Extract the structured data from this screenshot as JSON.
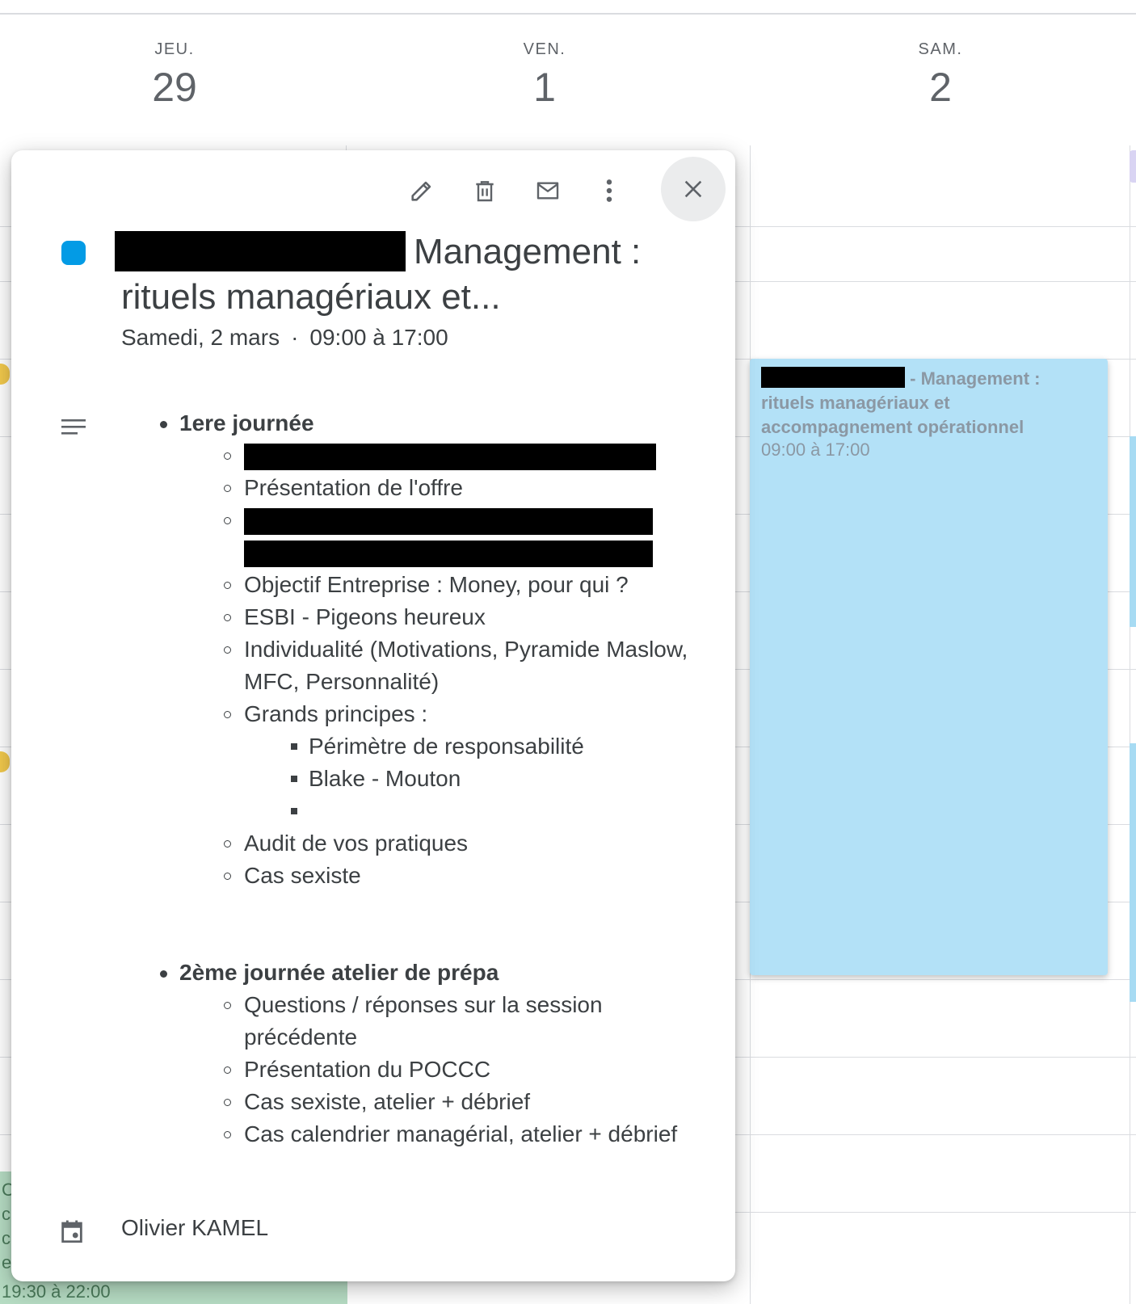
{
  "days": [
    {
      "dow": "JEU.",
      "num": "29"
    },
    {
      "dow": "VEN.",
      "num": "1"
    },
    {
      "dow": "SAM.",
      "num": "2"
    }
  ],
  "toolbar": {
    "edit_icon": "pencil-icon",
    "delete_icon": "trash-icon",
    "email_icon": "mail-icon",
    "more_icon": "more-vert-icon",
    "close_icon": "close-icon"
  },
  "event": {
    "color": "#039be5",
    "title_line1": "Management :",
    "title_line2": "rituels managériaux et...",
    "date": "Samedi, 2 mars",
    "separator": "·",
    "time": "09:00 à 17:00",
    "owner": "Olivier KAMEL"
  },
  "description": {
    "day1": {
      "heading": "1ere journée",
      "items": [
        "Présentation de l'offre",
        "Objectif Entreprise : Money, pour qui ?",
        "ESBI - Pigeons heureux",
        "Individualité (Motivations, Pyramide Maslow, MFC, Personnalité)",
        "Grands principes :",
        "Audit de vos pratiques",
        "Cas sexiste"
      ],
      "sub_items": [
        "Périmètre de responsabilité",
        "Blake - Mouton",
        ""
      ]
    },
    "day2": {
      "heading": "2ème journée atelier de prépa",
      "items": [
        "Questions / réponses sur la session précédente",
        "Présentation du POCCC",
        "Cas sexiste, atelier + débrief",
        "Cas calendrier managérial, atelier + débrief"
      ]
    }
  },
  "calendar_event": {
    "title": "- Management : rituels managériaux et accompagnement opérationnel",
    "time": "09:00 à 17:00",
    "color": "#b3e1f7"
  },
  "other_event": {
    "time": "19:30 à 22:00",
    "letters": [
      "C",
      "c",
      "c",
      "e"
    ],
    "color": "#b6dcc3"
  }
}
